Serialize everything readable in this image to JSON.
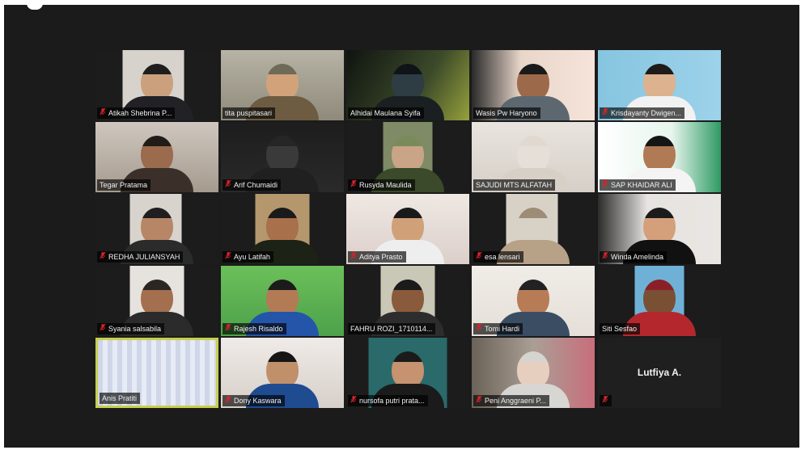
{
  "colors": {
    "window_bg": "#1b1b1b",
    "active_speaker_border": "#c8cf4d",
    "muted_mic": "#d9222a"
  },
  "participants": [
    {
      "name": "Atikah Shebrina P...",
      "muted": true
    },
    {
      "name": "tita puspitasari",
      "muted": false
    },
    {
      "name": "Alhidai Maulana Syifa",
      "muted": false
    },
    {
      "name": "Wasis Pw Haryono",
      "muted": false
    },
    {
      "name": "Krisdayanty Dwigen...",
      "muted": true
    },
    {
      "name": "Tegar Pratama",
      "muted": false
    },
    {
      "name": "Arif Chumaidi",
      "muted": true
    },
    {
      "name": "Rusyda Maulida",
      "muted": true
    },
    {
      "name": "SAJUDI MTS ALFATAH",
      "muted": false
    },
    {
      "name": "SAP KHAIDAR ALI",
      "muted": true
    },
    {
      "name": "REDHA JULIANSYAH",
      "muted": true
    },
    {
      "name": "Ayu Latifah",
      "muted": true
    },
    {
      "name": "Aditya Prasto",
      "muted": true
    },
    {
      "name": "esa lensari",
      "muted": true
    },
    {
      "name": "Winda Amelinda",
      "muted": true
    },
    {
      "name": "Syania salsabila",
      "muted": true
    },
    {
      "name": "Rajesh Risaldo",
      "muted": true
    },
    {
      "name": "FAHRU ROZI_1710114...",
      "muted": false
    },
    {
      "name": "Tomi Hardi",
      "muted": true
    },
    {
      "name": "Siti Sesfao",
      "muted": false
    },
    {
      "name": "Anis Pratiti",
      "muted": false
    },
    {
      "name": "Dony Kaswara",
      "muted": true
    },
    {
      "name": "nursofa putri prata...",
      "muted": true
    },
    {
      "name": "Peni Anggraeni P...",
      "muted": true
    },
    {
      "name": "",
      "muted": true
    }
  ],
  "camera_off_participant": {
    "display_name": "Lutfiya A."
  }
}
